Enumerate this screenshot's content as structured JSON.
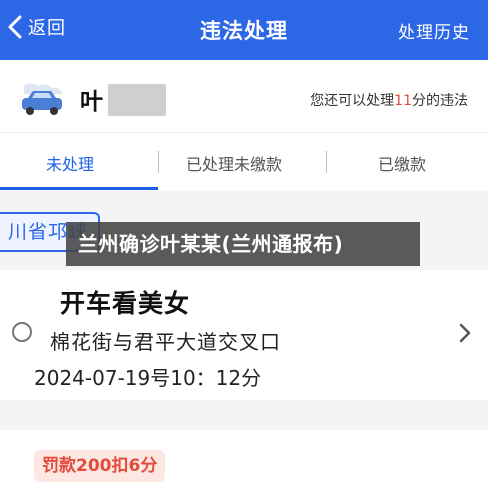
{
  "header": {
    "back_label": "返回",
    "title": "违法处理",
    "history_label": "处理历史"
  },
  "plate": {
    "prefix": "叶"
  },
  "remaining": {
    "prefix": "您还可以处理",
    "count": "11",
    "suffix": "分的违法"
  },
  "tabs": [
    {
      "label": "未处理",
      "active": true
    },
    {
      "label": "已处理未缴款",
      "active": false
    },
    {
      "label": "已缴款",
      "active": false
    }
  ],
  "region_tag": "川省邛崃",
  "overlay_text": "兰州确诊叶某某(兰州通报布)",
  "record": {
    "reason": "开车看美女",
    "location": "棉花街与君平大道交叉口",
    "time": "2024-07-19号10：12分",
    "penalty": "罚款200扣6分"
  },
  "colors": {
    "header_bg": "#2c68e6",
    "accent": "#1f62e6",
    "warn": "#e34b3a"
  }
}
